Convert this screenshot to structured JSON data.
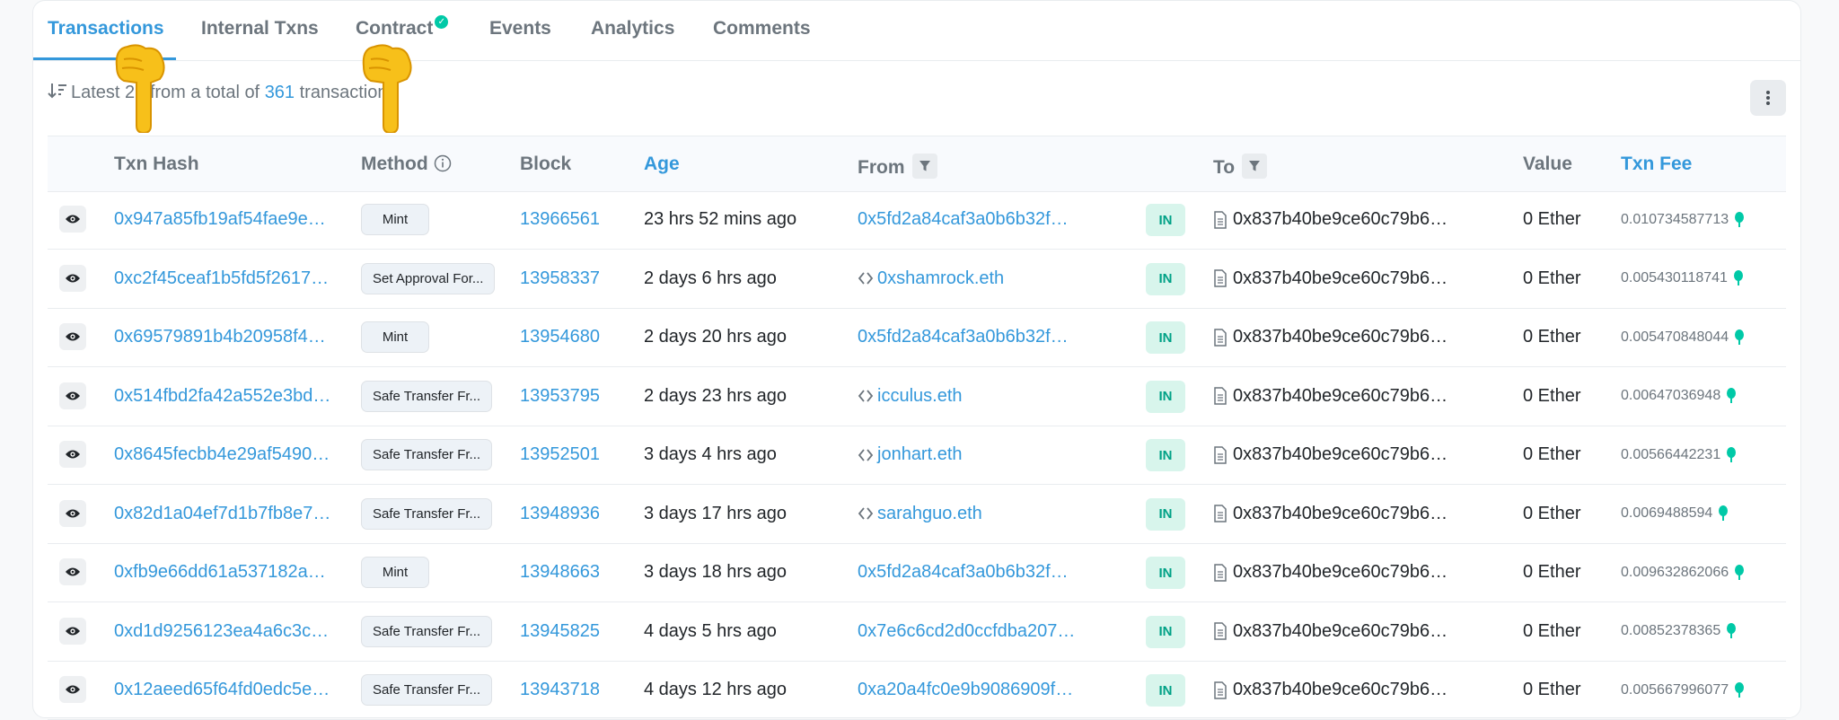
{
  "tabs": [
    {
      "label": "Transactions"
    },
    {
      "label": "Internal Txns"
    },
    {
      "label": "Contract"
    },
    {
      "label": "Events"
    },
    {
      "label": "Analytics"
    },
    {
      "label": "Comments"
    }
  ],
  "summary": {
    "prefix": "Latest 25 from a total of",
    "count": "361",
    "suffix": "transactions"
  },
  "columns": {
    "txn_hash": "Txn Hash",
    "method": "Method",
    "block": "Block",
    "age": "Age",
    "from": "From",
    "to": "To",
    "value": "Value",
    "txn_fee": "Txn Fee"
  },
  "colors": {
    "accent": "#3498db",
    "in_badge_bg": "#d8f5ec",
    "in_badge_text": "#00a186"
  },
  "icons": [
    "sort-icon",
    "more-vertical-icon",
    "filter-icon",
    "info-icon",
    "eye-icon",
    "ens-icon",
    "document-icon",
    "gas-icon",
    "verified-check-icon",
    "pointing-hand-icon"
  ],
  "rows": [
    {
      "hash": "0x947a85fb19af54fae9e…",
      "method": "Mint",
      "block": "13966561",
      "age": "23 hrs 52 mins ago",
      "from": "0x5fd2a84caf3a0b6b32f…",
      "from_ens": false,
      "direction": "IN",
      "to": "0x837b40be9ce60c79b6…",
      "value": "0 Ether",
      "fee": "0.010734587713"
    },
    {
      "hash": "0xc2f45ceaf1b5fd5f2617…",
      "method": "Set Approval For...",
      "block": "13958337",
      "age": "2 days 6 hrs ago",
      "from": "0xshamrock.eth",
      "from_ens": true,
      "direction": "IN",
      "to": "0x837b40be9ce60c79b6…",
      "value": "0 Ether",
      "fee": "0.005430118741"
    },
    {
      "hash": "0x69579891b4b20958f4…",
      "method": "Mint",
      "block": "13954680",
      "age": "2 days 20 hrs ago",
      "from": "0x5fd2a84caf3a0b6b32f…",
      "from_ens": false,
      "direction": "IN",
      "to": "0x837b40be9ce60c79b6…",
      "value": "0 Ether",
      "fee": "0.005470848044"
    },
    {
      "hash": "0x514fbd2fa42a552e3bd…",
      "method": "Safe Transfer Fr...",
      "block": "13953795",
      "age": "2 days 23 hrs ago",
      "from": "icculus.eth",
      "from_ens": true,
      "direction": "IN",
      "to": "0x837b40be9ce60c79b6…",
      "value": "0 Ether",
      "fee": "0.00647036948"
    },
    {
      "hash": "0x8645fecbb4e29af5490…",
      "method": "Safe Transfer Fr...",
      "block": "13952501",
      "age": "3 days 4 hrs ago",
      "from": "jonhart.eth",
      "from_ens": true,
      "direction": "IN",
      "to": "0x837b40be9ce60c79b6…",
      "value": "0 Ether",
      "fee": "0.00566442231"
    },
    {
      "hash": "0x82d1a04ef7d1b7fb8e7…",
      "method": "Safe Transfer Fr...",
      "block": "13948936",
      "age": "3 days 17 hrs ago",
      "from": "sarahguo.eth",
      "from_ens": true,
      "direction": "IN",
      "to": "0x837b40be9ce60c79b6…",
      "value": "0 Ether",
      "fee": "0.0069488594"
    },
    {
      "hash": "0xfb9e66dd61a537182a…",
      "method": "Mint",
      "block": "13948663",
      "age": "3 days 18 hrs ago",
      "from": "0x5fd2a84caf3a0b6b32f…",
      "from_ens": false,
      "direction": "IN",
      "to": "0x837b40be9ce60c79b6…",
      "value": "0 Ether",
      "fee": "0.009632862066"
    },
    {
      "hash": "0xd1d9256123ea4a6c3c…",
      "method": "Safe Transfer Fr...",
      "block": "13945825",
      "age": "4 days 5 hrs ago",
      "from": "0x7e6c6cd2d0ccfdba207…",
      "from_ens": false,
      "direction": "IN",
      "to": "0x837b40be9ce60c79b6…",
      "value": "0 Ether",
      "fee": "0.00852378365"
    },
    {
      "hash": "0x12aeed65f64fd0edc5e…",
      "method": "Safe Transfer Fr...",
      "block": "13943718",
      "age": "4 days 12 hrs ago",
      "from": "0xa20a4fc0e9b9086909f…",
      "from_ens": false,
      "direction": "IN",
      "to": "0x837b40be9ce60c79b6…",
      "value": "0 Ether",
      "fee": "0.005667996077"
    }
  ]
}
